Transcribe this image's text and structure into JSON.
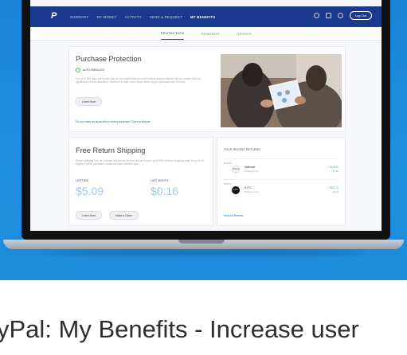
{
  "nav": {
    "logo": "P",
    "items": [
      "Summary",
      "My Money",
      "Activity",
      "Send & Request",
      "My Benefits"
    ],
    "active_index": 4,
    "logout_label": "Log Out"
  },
  "subtabs": {
    "items": [
      "Protection",
      "Rewards",
      "Offers"
    ],
    "active_index": 0
  },
  "purchase_protection": {
    "title": "Purchase Protection",
    "status": "Auto Enrolled",
    "description": "For up to 180 days, we'll cover you for purchases that you don't receive and purchases that you receive that are significantly not as described. Visit here to learn more about which of your purchases are covered.",
    "learn_more_label": "Learn More",
    "issue_link": "Do you have an issue with a recent purchase? Open a dispute."
  },
  "free_return_shipping": {
    "title": "Free Return Shipping",
    "description": "Return shipping's on us. Activate this service for free and we'll cover up to $30 of return shipping costs for up to 12 eligible PayPal purchases combined each calendar year.",
    "lifetime_label": "Lifetime",
    "lifetime_value": "$5.09",
    "last_month_label": "Last Month",
    "last_month_value": "$0.16",
    "learn_more_label": "Learn More",
    "make_claim_label": "Make a Claim"
  },
  "recent_returns": {
    "title": "Your Recent Returns",
    "rows": [
      {
        "date": "MAR 28",
        "avatar": "Walmart",
        "name": "Walmart",
        "sub": "Shipping Cost",
        "amount": "+ $15.20",
        "amount_sub": "+ $0.00"
      },
      {
        "date": "MAR 19",
        "avatar": "A.P.C.",
        "name": "A.P.C.",
        "sub": "Shipping Cost",
        "amount": "+ $30.70",
        "amount_sub": "+ $0.00"
      }
    ],
    "view_all_label": "View All Returns"
  },
  "caption": "yPal: My Benefits - Increase user"
}
